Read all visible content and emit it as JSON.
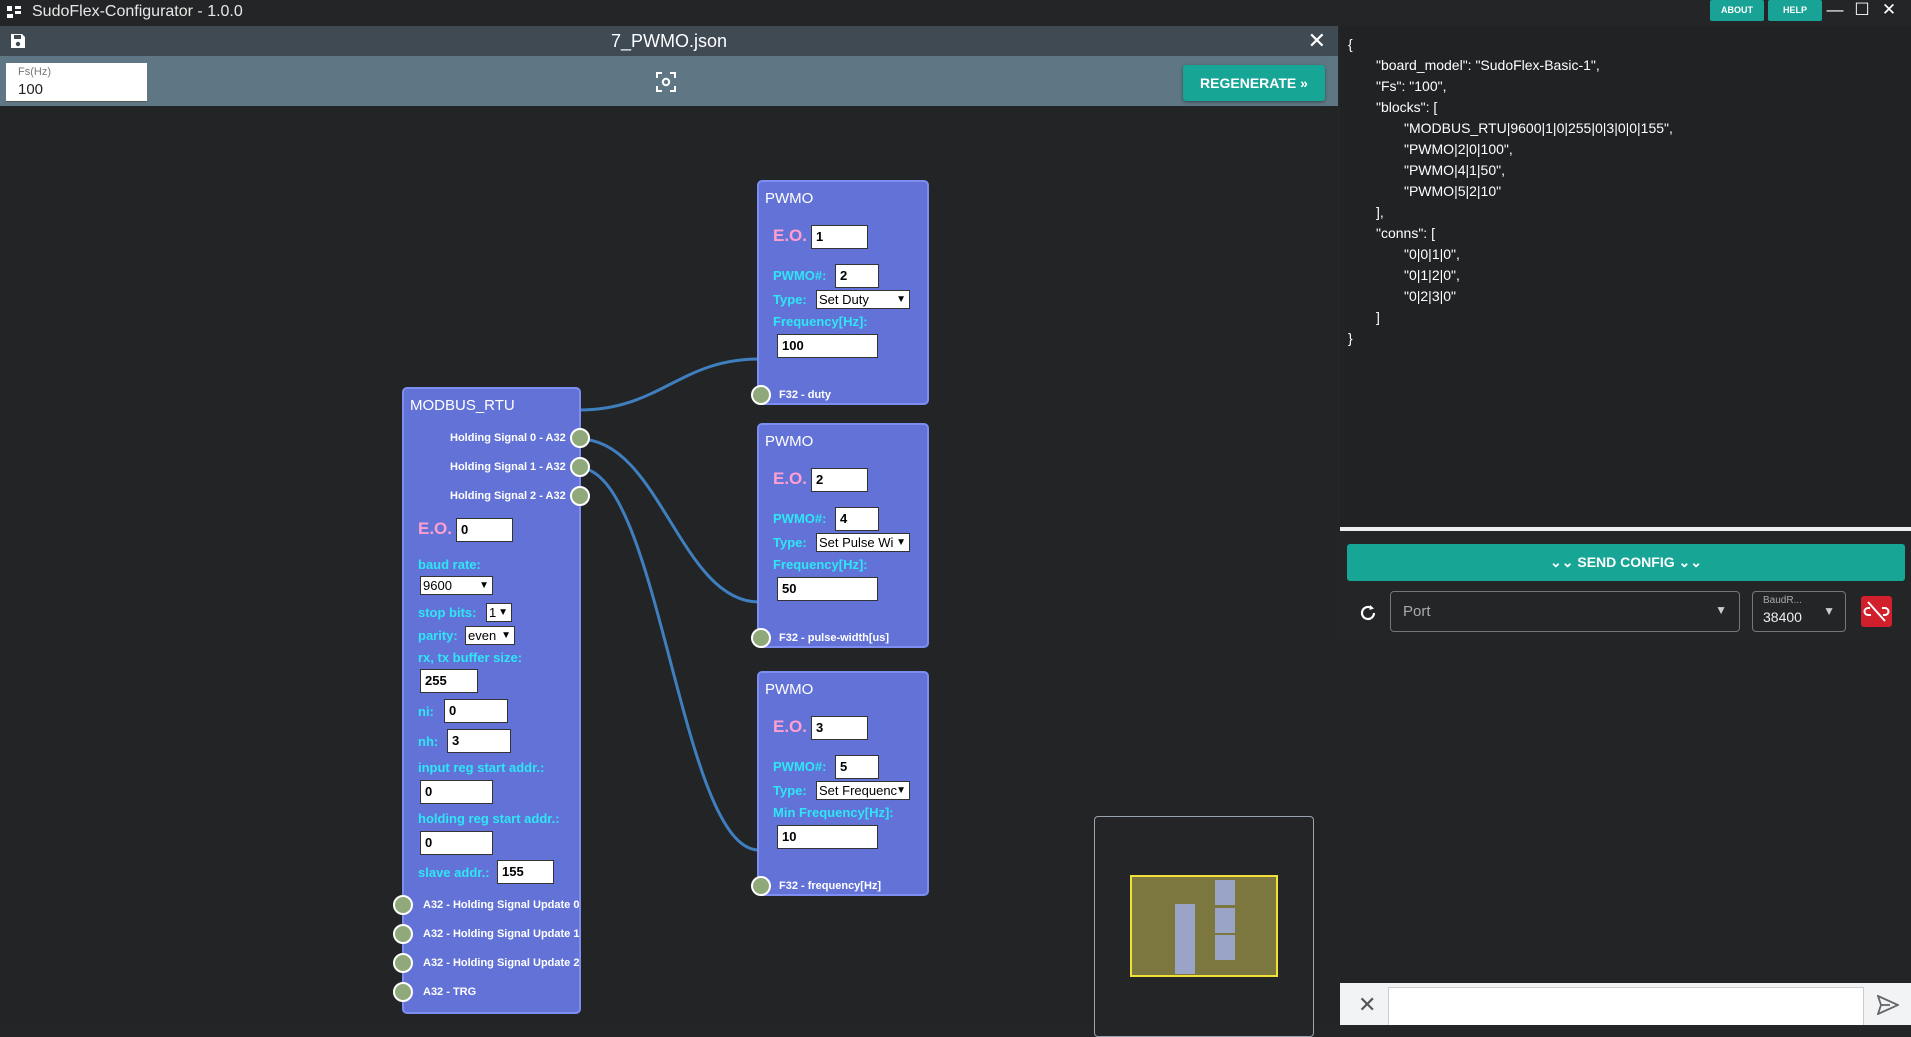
{
  "window": {
    "title": "SudoFlex-Configurator - 1.0.0",
    "about_label": "ABOUT",
    "help_label": "HELP"
  },
  "editor": {
    "filename": "7_PWMO.json",
    "fs_label": "Fs(Hz)",
    "fs_value": "100",
    "regenerate_label": "REGENERATE"
  },
  "modbus": {
    "title": "MODBUS_RTU",
    "outputs": [
      "Holding Signal 0 - A32",
      "Holding Signal 1 - A32",
      "Holding Signal 2 - A32"
    ],
    "eo_label": "E.O.",
    "eo_value": "0",
    "baud_label": "baud rate:",
    "baud_value": "9600",
    "stop_label": "stop bits:",
    "stop_value": "1",
    "parity_label": "parity:",
    "parity_value": "even",
    "buf_label": "rx, tx buffer size:",
    "buf_value": "255",
    "ni_label": "ni:",
    "ni_value": "0",
    "nh_label": "nh:",
    "nh_value": "3",
    "inreg_label": "input reg start addr.:",
    "inreg_value": "0",
    "holdreg_label": "holding reg start addr.:",
    "holdreg_value": "0",
    "slave_label": "slave addr.:",
    "slave_value": "155",
    "inputs": [
      "A32 - Holding Signal Update 0",
      "A32 - Holding Signal Update 1",
      "A32 - Holding Signal Update 2",
      "A32 - TRG"
    ]
  },
  "pwmo": [
    {
      "title": "PWMO",
      "eo_label": "E.O.",
      "eo_value": "1",
      "num_label": "PWMO#:",
      "num_value": "2",
      "type_label": "Type:",
      "type_value": "Set Duty",
      "freq_label": "Frequency[Hz]:",
      "freq_value": "100",
      "input_label": "F32 - duty"
    },
    {
      "title": "PWMO",
      "eo_label": "E.O.",
      "eo_value": "2",
      "num_label": "PWMO#:",
      "num_value": "4",
      "type_label": "Type:",
      "type_value": "Set Pulse Wi",
      "freq_label": "Frequency[Hz]:",
      "freq_value": "50",
      "input_label": "F32 - pulse-width[us]"
    },
    {
      "title": "PWMO",
      "eo_label": "E.O.",
      "eo_value": "3",
      "num_label": "PWMO#:",
      "num_value": "5",
      "type_label": "Type:",
      "type_value": "Set Frequenc",
      "freq_label": "Min Frequency[Hz]:",
      "freq_value": "10",
      "input_label": "F32 - frequency[Hz]"
    }
  ],
  "json_lines": [
    "{",
    "\"board_model\": \"SudoFlex-Basic-1\",",
    "\"Fs\": \"100\",",
    "\"blocks\": [",
    "\"MODBUS_RTU|9600|1|0|255|0|3|0|0|155\",",
    "\"PWMO|2|0|100\",",
    "\"PWMO|4|1|50\",",
    "\"PWMO|5|2|10\"",
    "],",
    "\"conns\": [",
    "\"0|0|1|0\",",
    "\"0|1|2|0\",",
    "\"0|2|3|0\"",
    "]",
    "}"
  ],
  "serial": {
    "send_config_label": "SEND CONFIG",
    "port_placeholder": "Port",
    "baud_label": "BaudR...",
    "baud_value": "38400"
  },
  "colors": {
    "accent": "#17a596",
    "node": "#6272d6",
    "label_cyan": "#2ee6f5",
    "label_pink": "#ff9fd0",
    "wire": "#3f7fbf",
    "disconnect": "#d11f2c"
  },
  "icons": {
    "save": "save-icon",
    "close": "close-icon",
    "focus": "focus-icon",
    "refresh": "refresh-icon",
    "link_off": "link-off-icon",
    "send": "send-icon"
  }
}
